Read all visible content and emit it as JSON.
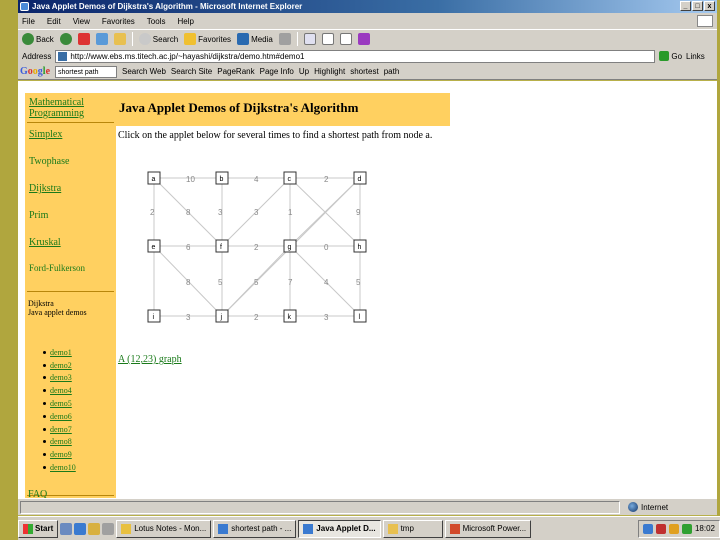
{
  "window": {
    "title": "Java Applet Demos of Dijkstra's Algorithm - Microsoft Internet Explorer",
    "controls": [
      "_",
      "□",
      "x"
    ]
  },
  "menu": [
    "File",
    "Edit",
    "View",
    "Favorites",
    "Tools",
    "Help"
  ],
  "toolbar": {
    "back": "Back",
    "search": "Search",
    "favorites": "Favorites",
    "media": "Media"
  },
  "address": {
    "label": "Address",
    "url": "http://www.ebs.ms.titech.ac.jp/~hayashi/dijkstra/demo.htm#demo1",
    "go": "Go",
    "links": "Links"
  },
  "google": {
    "logo": "Google",
    "search_value": "shortest path",
    "buttons": [
      "Search Web",
      "Search Site",
      "PageRank",
      "Page Info",
      "Up",
      "Highlight",
      "shortest",
      "path"
    ]
  },
  "sidebar": {
    "top_link": "Mathematical Programming",
    "links": [
      "Simplex",
      "Twophase",
      "Dijkstra",
      "Prim",
      "Kruskal",
      "Ford-Fulkerson"
    ],
    "section_title": "Dijkstra",
    "section_subtitle": "Java applet demos",
    "demos": [
      "demo1",
      "demo2",
      "demo3",
      "demo4",
      "demo5",
      "demo6",
      "demo7",
      "demo8",
      "demo9",
      "demo10"
    ],
    "faq": "FAQ"
  },
  "main": {
    "title": "Java Applet Demos of Dijkstra's Algorithm",
    "instruction": "Click on the applet below for several times to find a shortest path from node a.",
    "graph_link": "A (12,23) graph"
  },
  "graph": {
    "nodes": [
      "a",
      "b",
      "c",
      "d",
      "e",
      "f",
      "g",
      "h",
      "i",
      "j",
      "k",
      "l"
    ],
    "row1_weights": [
      "10",
      "4",
      "2"
    ],
    "col1_weights": [
      "2",
      "8",
      "3",
      "3",
      "1",
      "9"
    ],
    "row2_weights": [
      "6",
      "2",
      "0"
    ],
    "col2_weights": [
      "8",
      "5",
      "5",
      "7",
      "4",
      "5"
    ],
    "row3_weights": [
      "3",
      "2",
      "3"
    ]
  },
  "status": {
    "zone": "Internet"
  },
  "taskbar": {
    "start": "Start",
    "tasks": [
      "Lotus Notes - Mon...",
      "shortest path - ...",
      "Java Applet D...",
      "tmp",
      "Microsoft Power..."
    ],
    "time": "18:02"
  }
}
